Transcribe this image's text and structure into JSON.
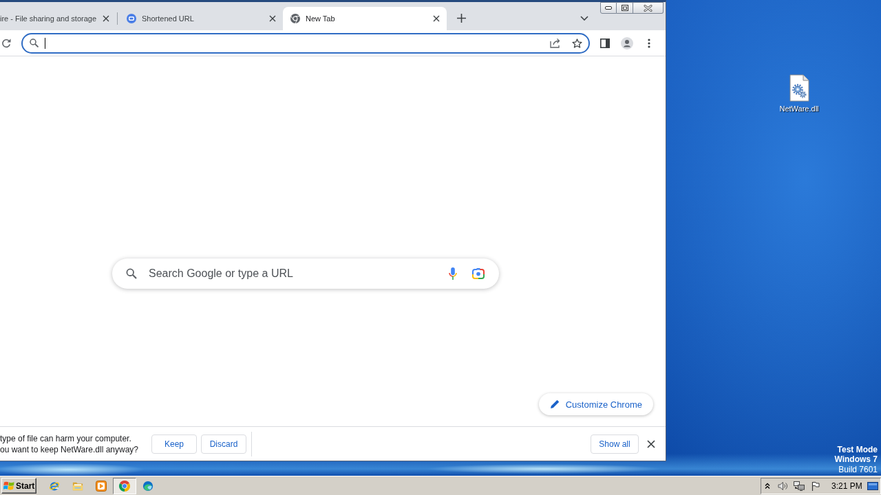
{
  "tabs": [
    {
      "title": "ire - File sharing and storage",
      "selected": false
    },
    {
      "title": "Shortened URL",
      "selected": false
    },
    {
      "title": "New Tab",
      "selected": true
    }
  ],
  "omnibox": {
    "focused": true
  },
  "new_tab_page": {
    "search": {
      "placeholder": "Search Google or type a URL"
    },
    "customize_button": "Customize Chrome"
  },
  "download_bar": {
    "warning": [
      "type of file can harm your computer.",
      "ou want to keep NetWare.dll anyway?"
    ],
    "buttons": [
      "Keep",
      "Discard"
    ],
    "show_all": "Show all"
  },
  "desktop": {
    "icons": [
      {
        "label": "NetWare.dll"
      }
    ],
    "os_notice": {
      "mode": "Test Mode",
      "edition": "Windows 7",
      "build": "Build 7601"
    }
  },
  "taskbar": {
    "start": "Start",
    "apps": [
      {
        "selected": false
      },
      {
        "selected": false
      },
      {
        "selected": false
      },
      {
        "selected": true
      },
      {
        "selected": false
      }
    ],
    "clock": "3:21 PM"
  }
}
